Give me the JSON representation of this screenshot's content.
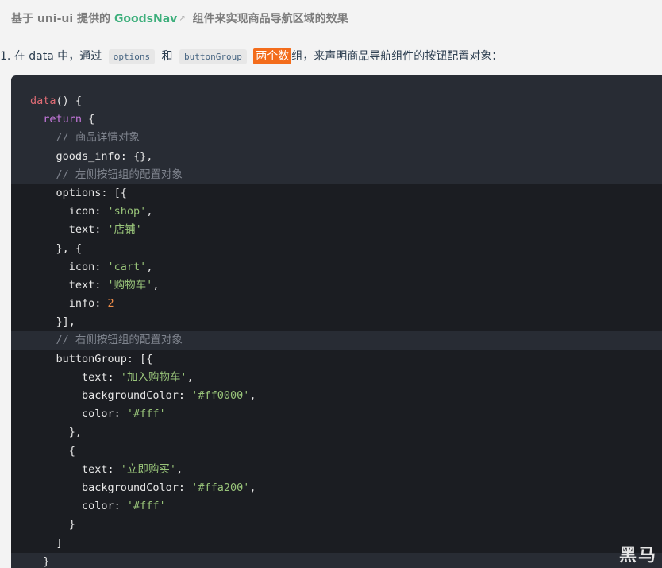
{
  "heading": {
    "prefix": "基于 uni-ui 提供的",
    "link": "GoodsNav",
    "ext_icon": "external-link-icon",
    "suffix": "组件来实现商品导航区域的效果"
  },
  "step": {
    "number": "1.",
    "text_a": "在 data 中，通过",
    "code_a": "options",
    "text_b": "和",
    "code_b": "buttonGroup",
    "highlight": "两个数",
    "text_c": "组，来声明商品导航组件的按钮配置对象："
  },
  "code_lines": [
    "data() {",
    "  return {",
    "    // 商品详情对象",
    "    goods_info: {},",
    "    // 左侧按钮组的配置对象",
    "    options: [{",
    "      icon: 'shop',",
    "      text: '店铺'",
    "    }, {",
    "      icon: 'cart',",
    "      text: '购物车',",
    "      info: 2",
    "    }],",
    "    // 右侧按钮组的配置对象",
    "    buttonGroup: [{",
    "        text: '加入购物车',",
    "        backgroundColor: '#ff0000',",
    "        color: '#fff'",
    "      },",
    "      {",
    "        text: '立即购买',",
    "        backgroundColor: '#ffa200',",
    "        color: '#fff'",
    "      }",
    "    ]",
    "  }"
  ],
  "watermark": "黑马",
  "colors": {
    "link": "#3eaf7c",
    "highlight": "#f36c1b",
    "code_bg": "#282c34"
  }
}
